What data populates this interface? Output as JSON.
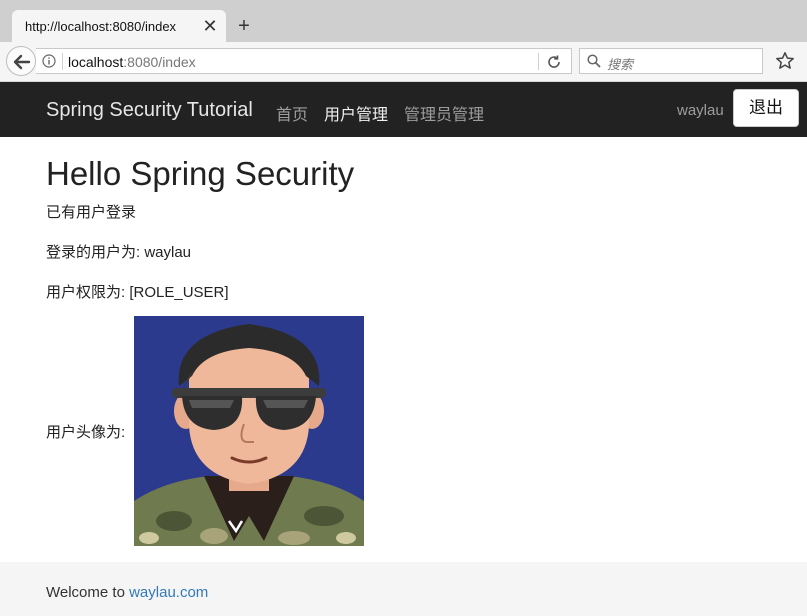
{
  "browser": {
    "tab_title": "http://localhost:8080/index",
    "tab_close": "✕",
    "new_tab": "+",
    "url_host": "localhost",
    "url_rest": ":8080/index",
    "search_placeholder": "搜索"
  },
  "navbar": {
    "brand": "Spring Security Tutorial",
    "links": [
      {
        "label": "首页",
        "active": false
      },
      {
        "label": "用户管理",
        "active": true
      },
      {
        "label": "管理员管理",
        "active": false
      }
    ],
    "username": "waylau",
    "logout_label": "退出"
  },
  "main": {
    "heading": "Hello Spring Security",
    "status": "已有用户登录",
    "user_line": "登录的用户为: waylau",
    "role_line": "用户权限为: [ROLE_USER]",
    "avatar_label": "用户头像为:"
  },
  "footer": {
    "prefix": "Welcome to ",
    "link_text": "waylau.com"
  },
  "colors": {
    "navbar_bg": "#222222",
    "link_blue": "#337ab7",
    "avatar_bg": "#2b3a8c"
  }
}
